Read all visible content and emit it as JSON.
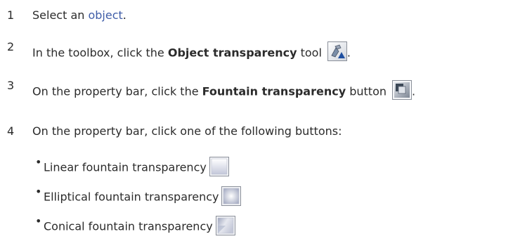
{
  "steps": [
    {
      "number": "1",
      "before": "Select an ",
      "link": "object",
      "after": "."
    },
    {
      "number": "2",
      "before": "In the toolbox, click the ",
      "bold": "Object transparency",
      "after": " tool",
      "icon": "object-transparency-tool-icon",
      "tail": "."
    },
    {
      "number": "3",
      "before": "On the property bar, click the ",
      "bold": "Fountain transparency",
      "after": " button",
      "icon": "fountain-transparency-button-icon",
      "tail": "."
    },
    {
      "number": "4",
      "text": "On the property bar, click one of the following buttons:"
    }
  ],
  "options": [
    {
      "label": "Linear fountain transparency",
      "icon": "linear-fountain-icon"
    },
    {
      "label": "Elliptical fountain transparency",
      "icon": "elliptical-fountain-icon"
    },
    {
      "label": "Conical fountain transparency",
      "icon": "conical-fountain-icon"
    }
  ],
  "colors": {
    "link": "#3f5da8",
    "text": "#2b2b2b"
  }
}
